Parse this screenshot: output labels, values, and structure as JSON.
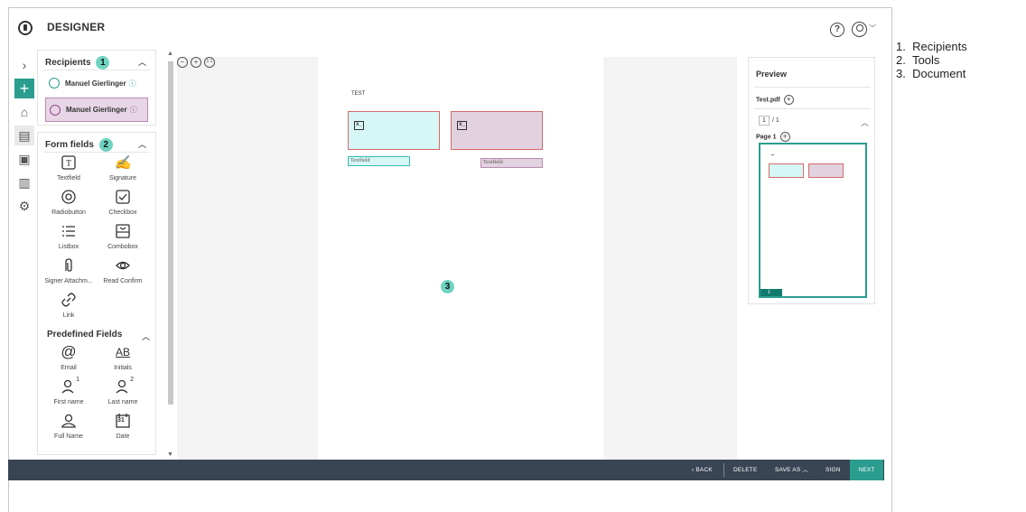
{
  "header": {
    "title": "DESIGNER"
  },
  "recipients": {
    "title": "Recipients",
    "badge": "1",
    "items": [
      {
        "name": "Manuel Gierlinger",
        "selected": false
      },
      {
        "name": "Manuel Gierlinger",
        "selected": true
      }
    ]
  },
  "form_fields": {
    "title": "Form fields",
    "badge": "2",
    "tools": [
      {
        "label": "Textfield",
        "icon": "textfield-icon"
      },
      {
        "label": "Signature",
        "icon": "signature-icon"
      },
      {
        "label": "Radiobutton",
        "icon": "radiobutton-icon"
      },
      {
        "label": "Checkbox",
        "icon": "checkbox-icon"
      },
      {
        "label": "Listbox",
        "icon": "listbox-icon"
      },
      {
        "label": "Combobox",
        "icon": "combobox-icon"
      },
      {
        "label": "Signer Attachm...",
        "icon": "attachment-icon"
      },
      {
        "label": "Read Confirm",
        "icon": "eye-icon"
      },
      {
        "label": "Link",
        "icon": "link-icon"
      }
    ],
    "predefined_title": "Predefined Fields",
    "predefined": [
      {
        "label": "Email",
        "icon": "at-icon",
        "glyph": "@"
      },
      {
        "label": "Initials",
        "icon": "initials-icon",
        "glyph": "AB"
      },
      {
        "label": "First name",
        "icon": "user-1-icon",
        "glyph": "1"
      },
      {
        "label": "Last name",
        "icon": "user-2-icon",
        "glyph": "2"
      },
      {
        "label": "Full Name",
        "icon": "user-icon"
      },
      {
        "label": "Date",
        "icon": "calendar-icon",
        "glyph": "31"
      }
    ]
  },
  "document": {
    "text": "TEST",
    "badge": "3",
    "fields": [
      {
        "label": "Textfield"
      },
      {
        "label": "Textfield"
      }
    ],
    "signature_glyph": "x_"
  },
  "preview": {
    "title": "Preview",
    "file": "Test.pdf",
    "page_current": "1",
    "page_total": "/ 1",
    "page_label": "Page 1",
    "thumb_page": "1"
  },
  "bottombar": {
    "back": "BACK",
    "delete": "DELETE",
    "save_as": "SAVE AS",
    "sign": "SIGN",
    "next": "NEXT"
  },
  "legend": [
    "Recipients",
    "Tools",
    "Document"
  ],
  "colors": {
    "accent": "#2a9d8f",
    "selected_recipient": "#e8d5e6",
    "bottom_bar": "#394454"
  }
}
